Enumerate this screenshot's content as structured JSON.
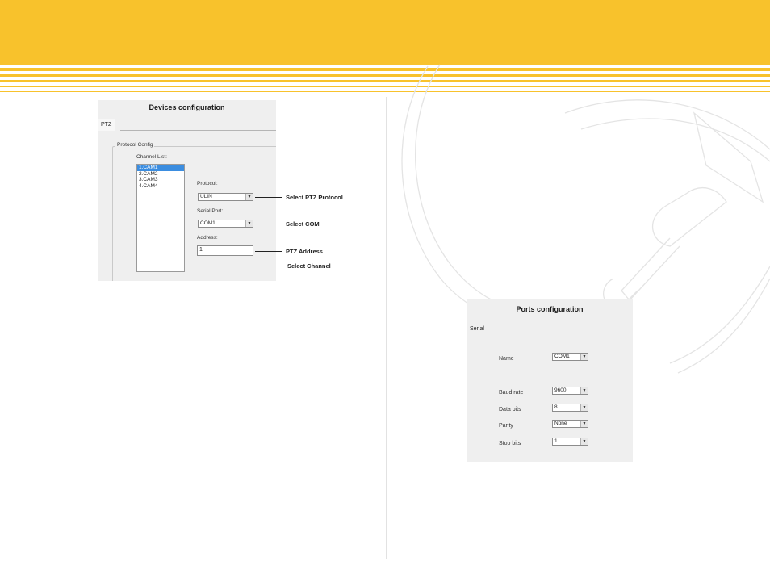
{
  "colors": {
    "banner": "#f8c22c",
    "selection": "#3b8de0",
    "panel": "#efefef"
  },
  "devices": {
    "title": "Devices configuration",
    "tab": "PTZ",
    "group_label": "Protocol Config",
    "channel_list_label": "Channel List:",
    "channels": [
      "1.CAM1",
      "2.CAM2",
      "3.CAM3",
      "4.CAM4"
    ],
    "selected_channel": "1.CAM1",
    "protocol_label": "Protocol:",
    "protocol_value": "ULIN",
    "serial_port_label": "Serial Port:",
    "serial_port_value": "COM1",
    "address_label": "Address:",
    "address_value": "1"
  },
  "callouts": {
    "protocol": "Select PTZ Protocol",
    "com": "Select COM",
    "address": "PTZ Address",
    "channel": "Select Channel"
  },
  "ports": {
    "title": "Ports configuration",
    "tab": "Serial",
    "name_label": "Name",
    "name_value": "COM1",
    "baud_label": "Baud rate",
    "baud_value": "9600",
    "data_bits_label": "Data bits",
    "data_bits_value": "8",
    "parity_label": "Parity",
    "parity_value": "None",
    "stop_bits_label": "Stop bits",
    "stop_bits_value": "1"
  }
}
